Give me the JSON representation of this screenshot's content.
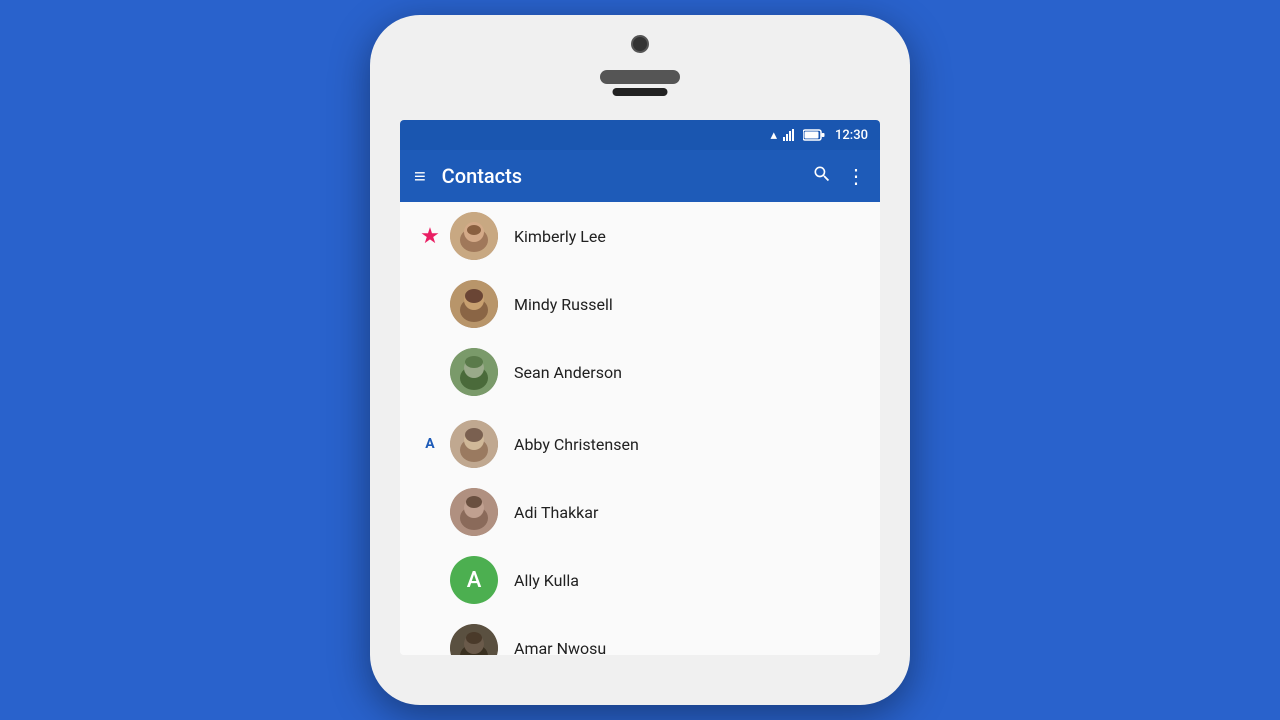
{
  "background": "#2962CC",
  "statusBar": {
    "time": "12:30"
  },
  "appBar": {
    "title": "Contacts",
    "hamburgerLabel": "≡",
    "searchLabel": "🔍",
    "moreLabel": "⋮"
  },
  "contacts": [
    {
      "id": "kimberly-lee",
      "name": "Kimberly Lee",
      "starred": true,
      "sectionMarker": null,
      "avatarType": "image",
      "avatarLetter": null,
      "avatarColor": null
    },
    {
      "id": "mindy-russell",
      "name": "Mindy Russell",
      "starred": false,
      "sectionMarker": null,
      "avatarType": "image",
      "avatarLetter": null,
      "avatarColor": null
    },
    {
      "id": "sean-anderson",
      "name": "Sean Anderson",
      "starred": false,
      "sectionMarker": null,
      "avatarType": "image",
      "avatarLetter": null,
      "avatarColor": null
    },
    {
      "id": "abby-christensen",
      "name": "Abby Christensen",
      "starred": false,
      "sectionMarker": "A",
      "avatarType": "image",
      "avatarLetter": null,
      "avatarColor": null
    },
    {
      "id": "adi-thakkar",
      "name": "Adi Thakkar",
      "starred": false,
      "sectionMarker": null,
      "avatarType": "image",
      "avatarLetter": null,
      "avatarColor": null
    },
    {
      "id": "ally-kulla",
      "name": "Ally Kulla",
      "starred": false,
      "sectionMarker": null,
      "avatarType": "letter",
      "avatarLetter": "A",
      "avatarColor": "#4CAF50"
    },
    {
      "id": "amar-nwosu",
      "name": "Amar Nwosu",
      "starred": false,
      "sectionMarker": null,
      "avatarType": "image",
      "avatarLetter": null,
      "avatarColor": null
    }
  ]
}
